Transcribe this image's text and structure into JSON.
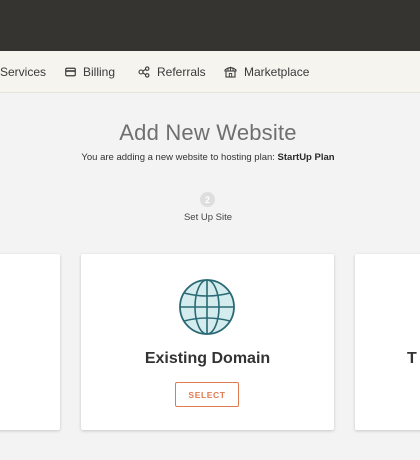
{
  "nav": {
    "items": [
      {
        "label": "Services",
        "icon": "services-icon"
      },
      {
        "label": "Billing",
        "icon": "billing-icon"
      },
      {
        "label": "Referrals",
        "icon": "referrals-icon"
      },
      {
        "label": "Marketplace",
        "icon": "marketplace-icon"
      }
    ]
  },
  "page": {
    "title": "Add New Website",
    "subtitle_prefix": "You are adding a new website to hosting plan:",
    "plan_name": "StartUp Plan"
  },
  "step": {
    "number": "2",
    "label": "Set Up Site"
  },
  "cards": {
    "main": {
      "icon": "globe-icon",
      "title": "Existing Domain",
      "button_label": "SELECT"
    },
    "right": {
      "title_partial": "T"
    }
  },
  "colors": {
    "topbar": "#363431",
    "navbar": "#f6f4ee",
    "accent": "#e07a4f",
    "globe_stroke": "#2a6a74",
    "globe_fill": "#d5ecef"
  }
}
